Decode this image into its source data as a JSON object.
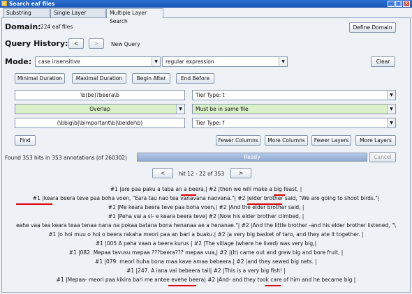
{
  "window": {
    "title": "Search eaf files"
  },
  "tabs": [
    "Substring Search",
    "Single Layer Search",
    "Multiple Layer Search"
  ],
  "domain": {
    "label": "Domain:",
    "value": "224 eaf files",
    "define_button": "Define Domain"
  },
  "history": {
    "label": "Query History:",
    "prev": "<",
    "next": ">",
    "new_query": "New Query"
  },
  "mode": {
    "label": "Mode:",
    "case": "case insensitive",
    "type": "regular expression",
    "clear": "Clear"
  },
  "constraints": [
    "Minimal Duration",
    "Maximal Duration",
    "Begin After",
    "End Before"
  ],
  "layers": {
    "pattern1": "\\b(be)?beera\\b",
    "tier1": "Tier Type: t",
    "relation": "Overlap",
    "file_constraint": "Must be in same file",
    "pattern2": "(\\bbig\\b|\\bimportant\\b|\\belder\\b)",
    "tier2": "Tier Type: f"
  },
  "actions": {
    "find": "Find",
    "fewer_columns": "Fewer Columns",
    "more_columns": "More Columns",
    "fewer_layers": "Fewer Layers",
    "more_layers": "More Layers"
  },
  "status": {
    "found": "Found 353 hits in 353 annotations (of 260302)",
    "progress": "Ready",
    "cancel": "Cancel"
  },
  "pager": {
    "prev": "<",
    "label": "hit 12 - 22 of 353",
    "next": ">"
  },
  "results": [
    "#1 |are paa paku a taba an a beera,|  #2 |then we will make a big feast, |",
    "#1 |keara beera teve paa boha voen, \"Eara tau nao tea vanavana naovana.\"|  #2 |elder brother said, \"We are going to shoot birds.\"|",
    "#1 |Me keara beera teve paa boha voen,|  #2 |And the elder brother said, |",
    "#1 |Peha vai a si- e keara beera teve|  #2 |Now his elder brother climbed, |",
    "eahe vaa tea keara teaa tenaa nana na pokaa batana bona henanaa ae a henanae.\"|  #2 |And the little brother -and his elder brother listened, \"\\",
    "#1 |o hoi muu o hoi o beera rakaha meori paa an bari a buaku.|  #2 |a very big basket of taro, and they ate it together. |",
    "#1 |005 A peha vaan a beera kurus |  #2 |The village (where he lived) was very big,|",
    "#1 |082. Mepaa tavusu mepaa ???beera??? mepaa vua,|  #2 |(It) came out and grew big and bore fruit, |",
    "#1 |079. meori huha bona maa kave amaa bebeera.|  #2 |and they sewed big nets. |",
    "#1 |247. A iana vai bebeera tail|  #2 |This is a very big fish! |",
    "#1 |Mepaa- meori paa kikira bari me antee evehe beera|  #2 |And- and they took care of him and he became big |"
  ]
}
